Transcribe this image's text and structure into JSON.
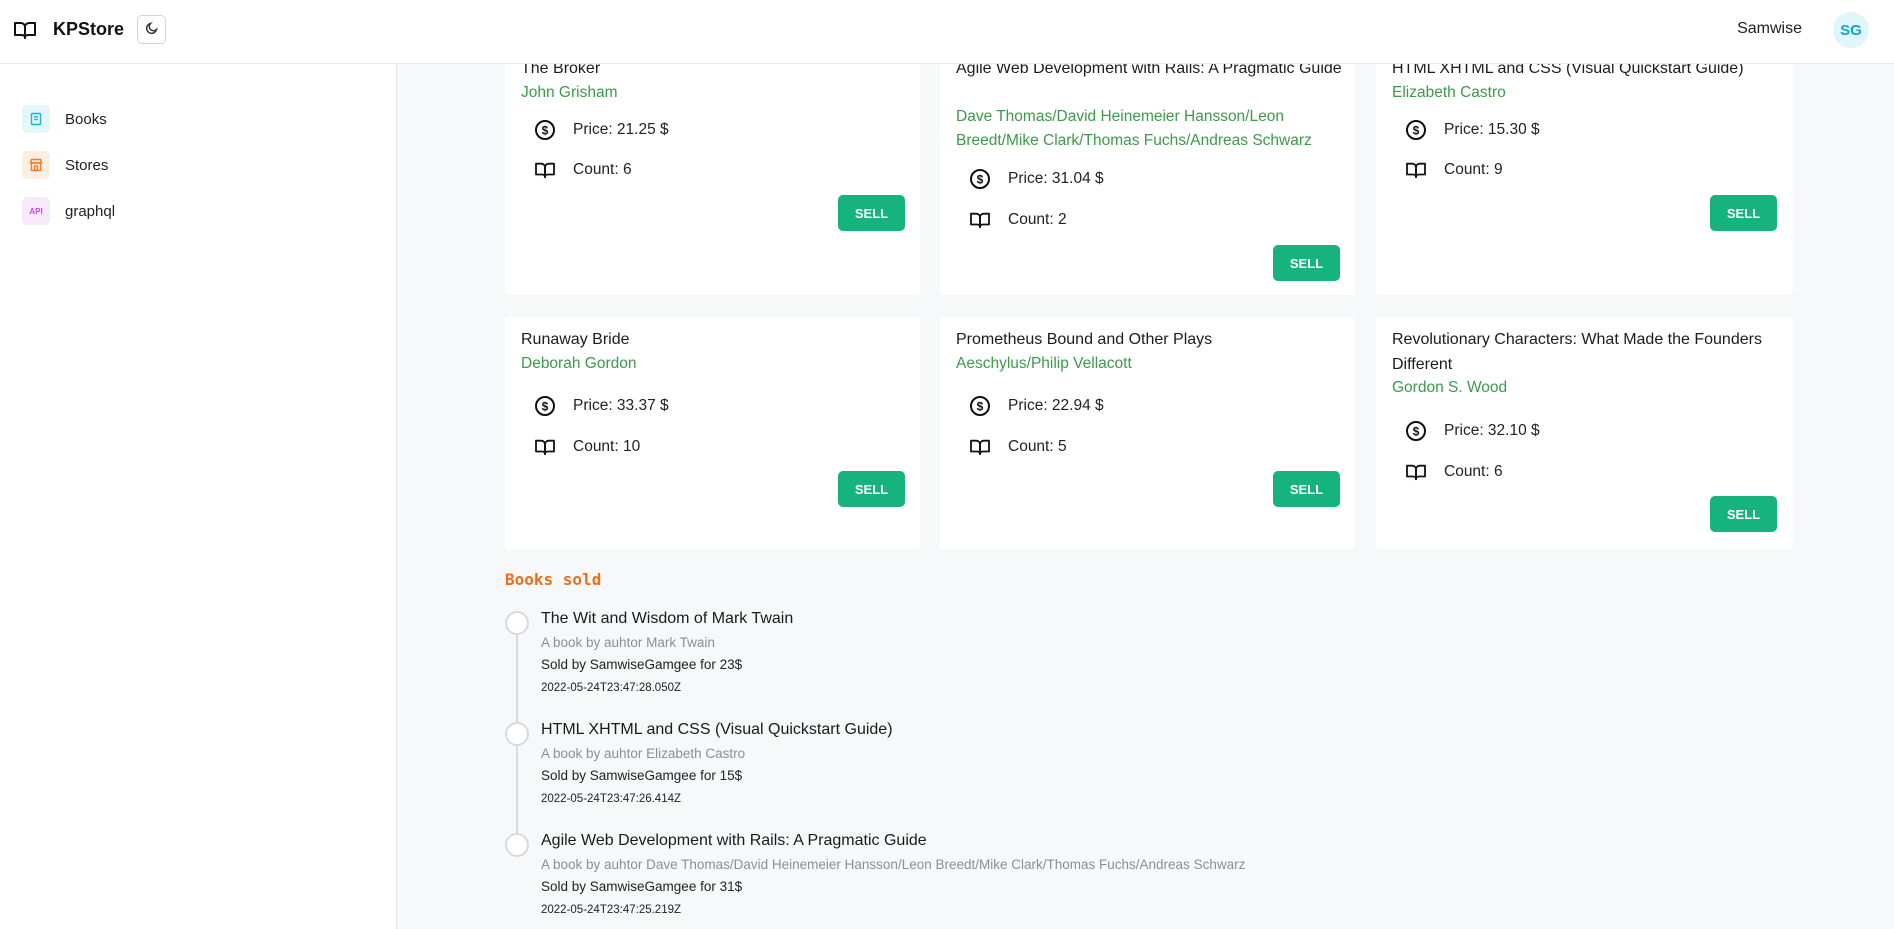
{
  "header": {
    "brand": "KPStore",
    "username": "Samwise",
    "avatar_initials": "SG"
  },
  "sidebar": {
    "items": [
      {
        "label": "Books",
        "icon": "book-icon",
        "color": "#1fb6c9"
      },
      {
        "label": "Stores",
        "icon": "store-icon",
        "color": "#f07a2b"
      },
      {
        "label": "graphql",
        "icon": "api-icon",
        "icon_text": "API",
        "color": "#c84ed8"
      }
    ]
  },
  "books": [
    {
      "title": "The Broker",
      "author": "John Grisham",
      "price": "Price: 21.25 $",
      "count": "Count: 6",
      "action": "SELL"
    },
    {
      "title": "Agile Web Development with Rails: A Pragmatic Guide",
      "author": "Dave Thomas/David Heinemeier Hansson/Leon Breedt/Mike Clark/Thomas Fuchs/Andreas Schwarz",
      "price": "Price: 31.04 $",
      "count": "Count: 2",
      "action": "SELL"
    },
    {
      "title": "HTML XHTML and CSS (Visual Quickstart Guide)",
      "author": "Elizabeth Castro",
      "price": "Price: 15.30 $",
      "count": "Count: 9",
      "action": "SELL"
    },
    {
      "title": "Runaway Bride",
      "author": "Deborah Gordon",
      "price": "Price: 33.37 $",
      "count": "Count: 10",
      "action": "SELL"
    },
    {
      "title": "Prometheus Bound and Other Plays",
      "author": "Aeschylus/Philip Vellacott",
      "price": "Price: 22.94 $",
      "count": "Count: 5",
      "action": "SELL"
    },
    {
      "title": "Revolutionary Characters: What Made the Founders Different",
      "author": "Gordon S. Wood",
      "price": "Price: 32.10 $",
      "count": "Count: 6",
      "action": "SELL"
    }
  ],
  "sold": {
    "title": "Books sold",
    "items": [
      {
        "title": "The Wit and Wisdom of Mark Twain",
        "subtitle": "A book by auhtor Mark Twain",
        "sold_by": "Sold by SamwiseGamgee for 23$",
        "timestamp": "2022-05-24T23:47:28.050Z"
      },
      {
        "title": "HTML XHTML and CSS (Visual Quickstart Guide)",
        "subtitle": "A book by auhtor Elizabeth Castro",
        "sold_by": "Sold by SamwiseGamgee for 15$",
        "timestamp": "2022-05-24T23:47:26.414Z"
      },
      {
        "title": "Agile Web Development with Rails: A Pragmatic Guide",
        "subtitle": "A book by auhtor Dave Thomas/David Heinemeier Hansson/Leon Breedt/Mike Clark/Thomas Fuchs/Andreas Schwarz",
        "sold_by": "Sold by SamwiseGamgee for 31$",
        "timestamp": "2022-05-24T23:47:25.219Z"
      }
    ]
  },
  "colors": {
    "accent": "#16b37e",
    "author": "#3c9a4a",
    "section_title": "#e8701a"
  }
}
